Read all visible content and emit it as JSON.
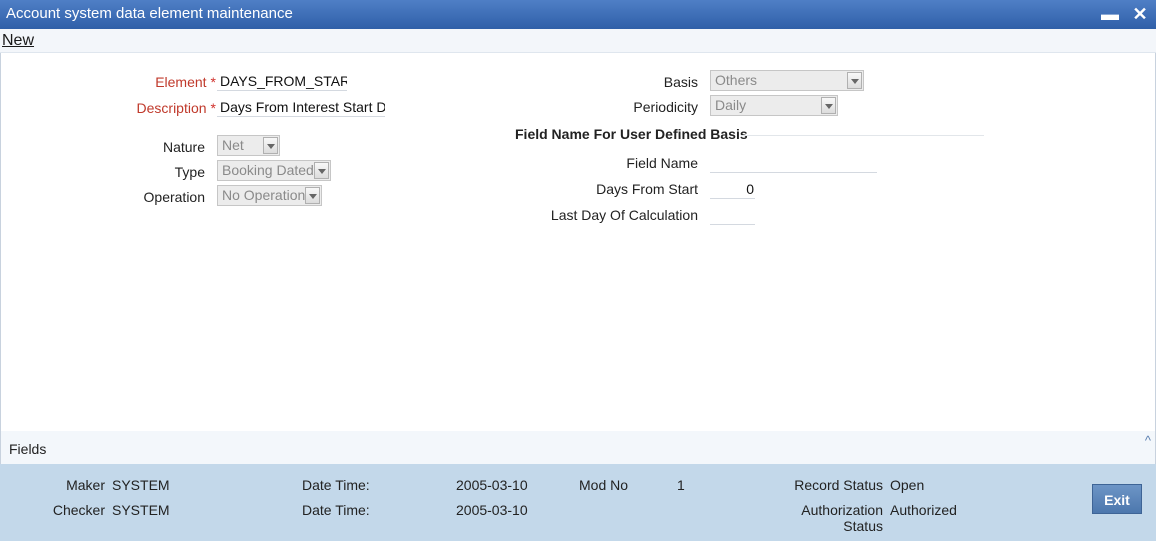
{
  "window": {
    "title": "Account system data element maintenance",
    "minimize_symbol": "▬",
    "close_symbol": "✕"
  },
  "toolbar": {
    "new_label": "New"
  },
  "form": {
    "element": {
      "label": "Element",
      "required_mark": "*",
      "value": "DAYS_FROM_START"
    },
    "description": {
      "label": "Description",
      "required_mark": "*",
      "value": "Days From Interest Start Da"
    },
    "nature": {
      "label": "Nature",
      "value": "Net"
    },
    "type": {
      "label": "Type",
      "value": "Booking Dated"
    },
    "operation": {
      "label": "Operation",
      "value": "No Operation"
    },
    "basis": {
      "label": "Basis",
      "value": "Others"
    },
    "periodicity": {
      "label": "Periodicity",
      "value": "Daily"
    },
    "user_defined_section": {
      "heading": "Field Name For User Defined Basis"
    },
    "field_name": {
      "label": "Field Name",
      "value": ""
    },
    "days_from_start": {
      "label": "Days From Start",
      "value": "0"
    },
    "last_day_of_calculation": {
      "label": "Last Day Of Calculation",
      "value": ""
    }
  },
  "fields_bar": {
    "label": "Fields",
    "caret": "^"
  },
  "footer": {
    "maker_label": "Maker",
    "maker_value": "SYSTEM",
    "checker_label": "Checker",
    "checker_value": "SYSTEM",
    "maker_datetime_label": "Date Time:",
    "maker_datetime_value": "2005-03-10",
    "checker_datetime_label": "Date Time:",
    "checker_datetime_value": "2005-03-10",
    "mod_no_label": "Mod No",
    "mod_no_value": "1",
    "record_status_label": "Record Status",
    "record_status_value": "Open",
    "auth_status_label_1": "Authorization",
    "auth_status_label_2": "Status",
    "auth_status_value": "Authorized",
    "exit_label": "Exit"
  },
  "colors": {
    "titlebar": "#2f5fa8",
    "required_label": "#c0392b",
    "footer_bg": "#c3d8ea",
    "exit_button": "#4c77ad"
  }
}
